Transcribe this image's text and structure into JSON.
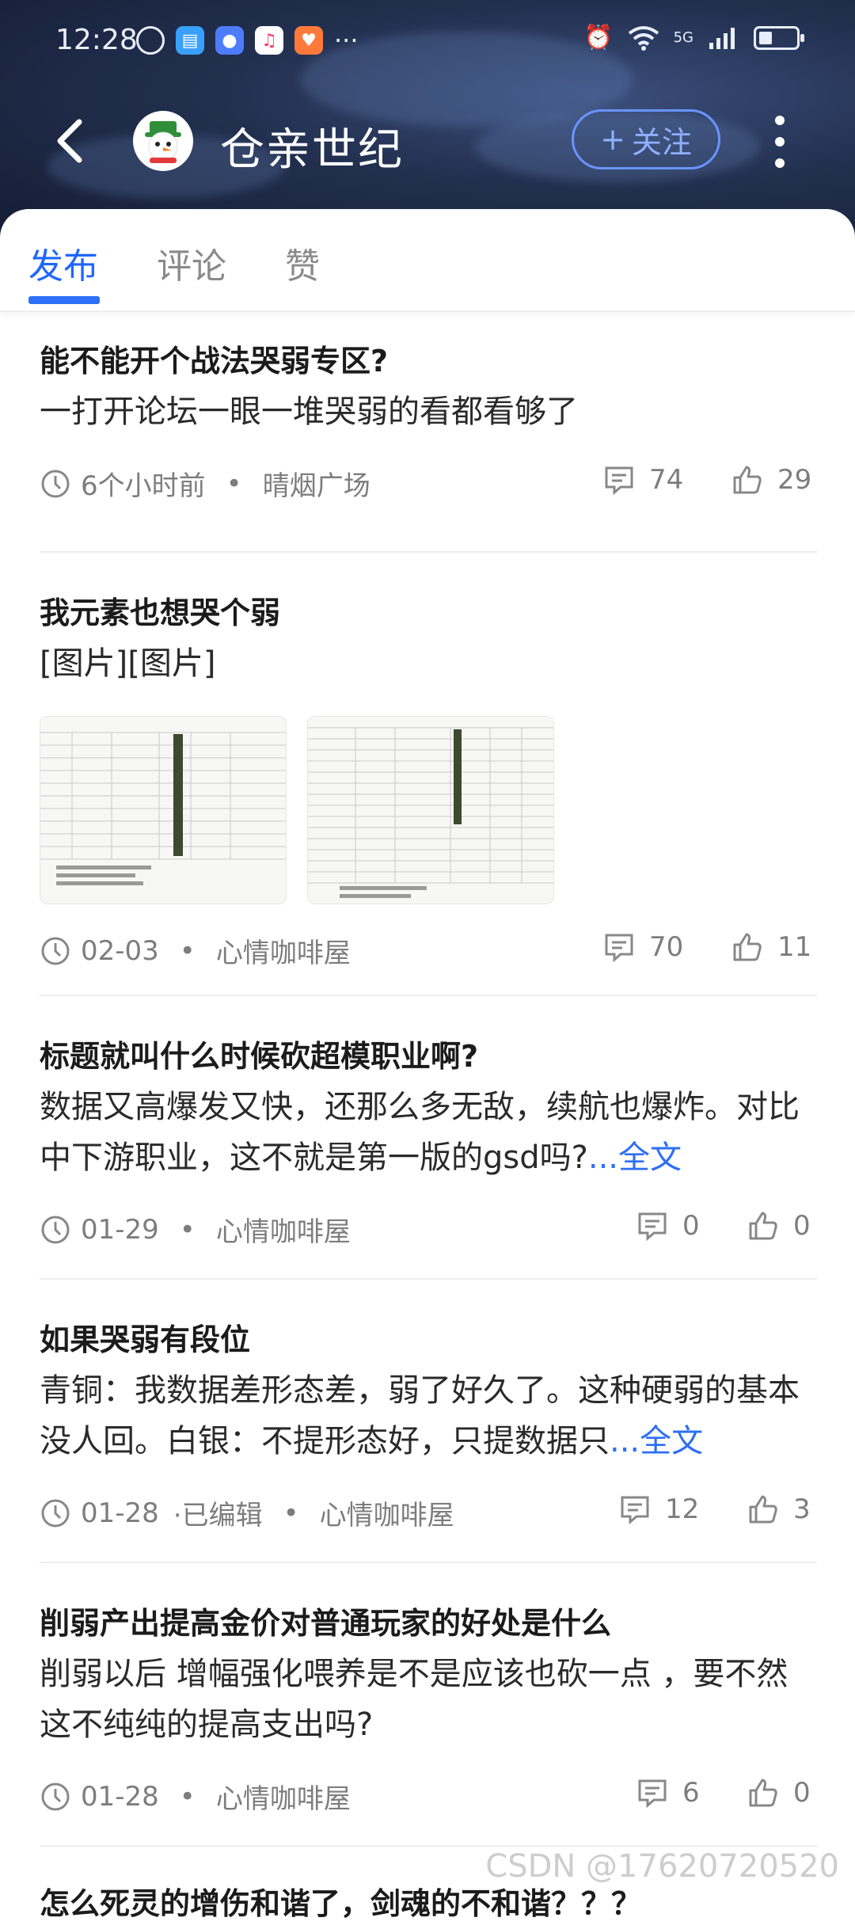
{
  "status": {
    "time": "12:28",
    "more": "···",
    "network": "5G"
  },
  "header": {
    "title": "仓亲世纪",
    "follow_label": "关注",
    "follow_plus": "+"
  },
  "tabs": [
    "发布",
    "评论",
    "赞"
  ],
  "posts": [
    {
      "title": "能不能开个战法哭弱专区?",
      "body": "一打开论坛一眼一堆哭弱的看都看够了",
      "time": "6个小时前",
      "board": "晴烟广场",
      "comments": "74",
      "likes": "29"
    },
    {
      "title": "我元素也想哭个弱",
      "body": "[图片][图片]",
      "time": "02-03",
      "board": "心情咖啡屋",
      "comments": "70",
      "likes": "11"
    },
    {
      "title": "标题就叫什么时候砍超模职业啊?",
      "body": "数据又高爆发又快，还那么多无敌，续航也爆炸。对比中下游职业，这不就是第一版的gsd吗?",
      "more": "...全文",
      "time": "01-29",
      "board": "心情咖啡屋",
      "comments": "0",
      "likes": "0"
    },
    {
      "title": "如果哭弱有段位",
      "body": " 青铜：我数据差形态差，弱了好久了。这种硬弱的基本没人回。白银：不提形态好，只提数据只",
      "more": "...全文",
      "time": "01-28",
      "edited": "·已编辑",
      "board": "心情咖啡屋",
      "comments": "12",
      "likes": "3"
    },
    {
      "title": "削弱产出提高金价对普通玩家的好处是什么",
      "body": "削弱以后 增幅强化喂养是不是应该也砍一点 ，要不然这不纯纯的提高支出吗?",
      "time": "01-28",
      "board": "心情咖啡屋",
      "comments": "6",
      "likes": "0"
    },
    {
      "title": "怎么死灵的增伤和谐了，剑魂的不和谐？？？"
    }
  ],
  "watermark": "CSDN @17620720520",
  "colors": {
    "accent": "#2d6ff5",
    "header_bg": "#1c2744"
  }
}
